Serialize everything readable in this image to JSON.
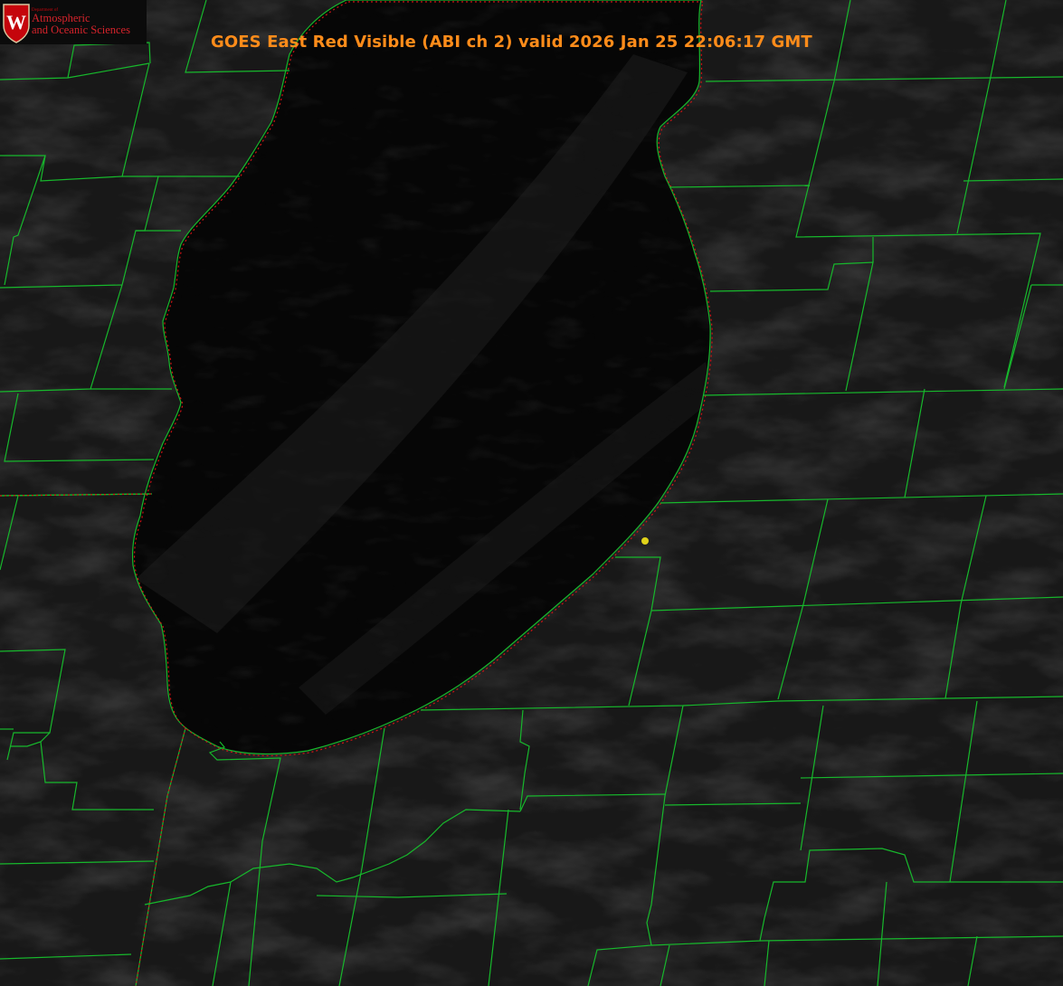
{
  "product": {
    "title": "GOES East Red Visible (ABI ch 2) valid 2026 Jan 25 22:06:17 GMT"
  },
  "logo": {
    "department": "Department of",
    "line1": "Atmospheric",
    "line2": "and Oceanic Sciences",
    "seal_letter": "W"
  },
  "colors": {
    "background": "#1a1a1a",
    "lake": "#050505",
    "county_lines": "#17b82c",
    "state_line": "#d01414",
    "title_text": "#ff8c1a",
    "marker": "#e0d21a",
    "logo_red": "#c5050c"
  },
  "map_features": [
    "lake-michigan",
    "county-boundaries",
    "state-boundaries",
    "station-marker"
  ]
}
